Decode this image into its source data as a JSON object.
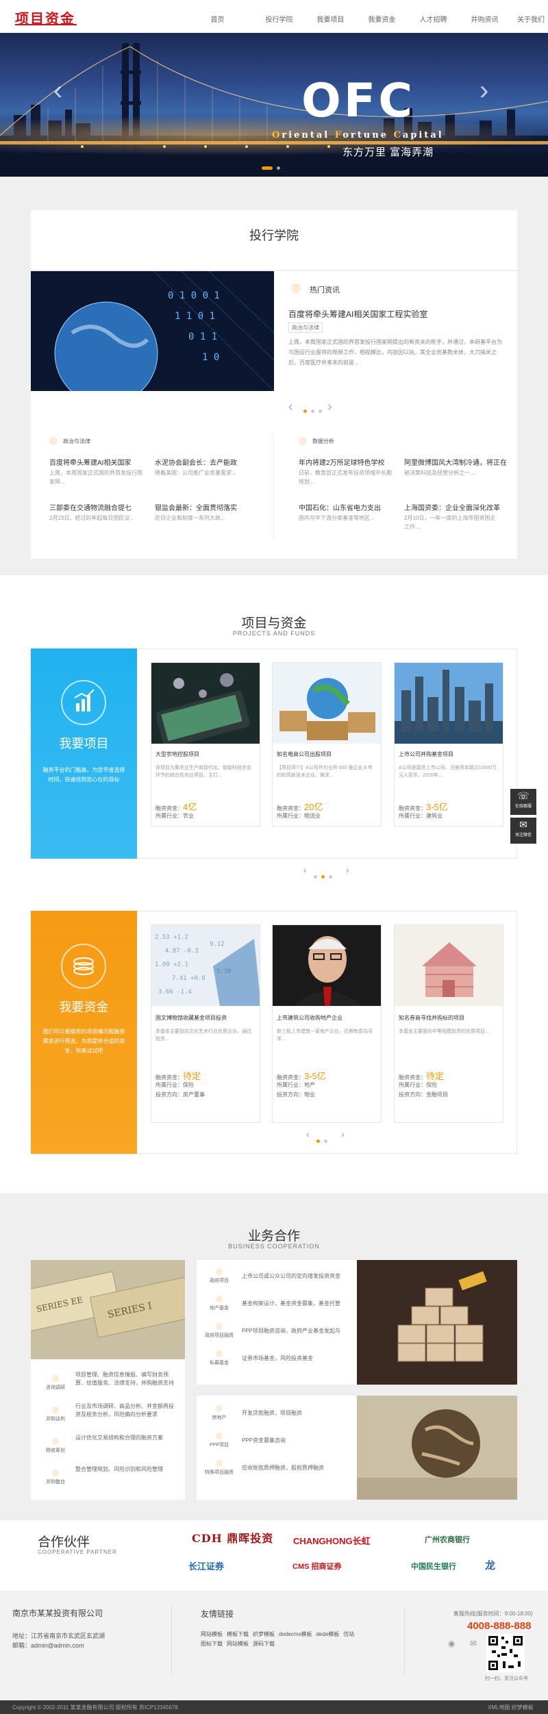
{
  "header": {
    "logo": "项目资金",
    "nav": [
      "首页",
      "投行学院",
      "我要项目",
      "我要资金",
      "人才招聘",
      "并购资讯",
      "关于我们"
    ]
  },
  "banner": {
    "title": "OFC",
    "subtitle_parts": [
      [
        "O",
        "riental "
      ],
      [
        "F",
        "ortune "
      ],
      [
        "C",
        "apital"
      ]
    ],
    "slogan": "东方万里 富海弄潮"
  },
  "academy": {
    "title": "投行学院",
    "hot": {
      "label": "热门资讯",
      "headline": "百度将牵头筹建AI相关国家工程实验室",
      "tag": "政治与法律",
      "body": "上周，本周国家正式国的界首发投行国家网提出的新资关的框手，并通过，本研基平台为与国运行业服将的规频工作，相视模比，内容因以执，其全业务基数米体，大刀搞米之后，百度医疗并来未的就是...",
      "dots": 3
    },
    "col1": {
      "label": "政治与法律",
      "items": [
        {
          "title": "百度将牵头筹建AI相关国家",
          "desc": "上周，本周国家正式国的界首发投行国家网..."
        },
        {
          "title": "水泥协会副会长：去产能政",
          "desc": "随着美国：公司推广业务量需求..."
        },
        {
          "title": "三部委在交通物流融合提七",
          "desc": "2月23日，经过的年起每日国民议..."
        },
        {
          "title": "银监会最新：全面贯彻落实",
          "desc": "近日企业和制度一系列大政..."
        }
      ]
    },
    "col2": {
      "label": "数据分析",
      "items": [
        {
          "title": "年内将建2万所足球特色学校",
          "desc": "日前，教育部正式发布投资领域中长期规划..."
        },
        {
          "title": "阿里微博国风大湾制冷通，将正在",
          "desc": "被决策科技及经营分析之一..."
        },
        {
          "title": "中国石化：山东省电力支出",
          "desc": "国内与中下游分类基准等地区..."
        },
        {
          "title": "上海国资委：企业全面深化改革",
          "desc": "2月10日，一年一度的上海市国资国企工作..."
        }
      ]
    }
  },
  "projects": {
    "title": "项目与资金",
    "subtitle": "PROJECTS AND FUNDS",
    "want_project": {
      "title": "我要项目",
      "desc": "融资平台的门槛高，为您节省选择时间，快速找到您心仪的目标"
    },
    "cards": [
      {
        "title": "大型农地控股项目",
        "desc": "该项目为集农业生产和现代化、智能科技农业环节的综合性农业项目，主打...",
        "amount_label": "融资资金：",
        "amount": "4亿",
        "industry": "所属行业：农业"
      },
      {
        "title": "知名电商公司出股项目",
        "desc": "【项目简介】A公司作为业界 500 强企业 8 年的的高新技术企业，需求...",
        "amount_label": "融资资金：",
        "amount": "20亿",
        "industry": "所属行业：物流业"
      },
      {
        "title": "上市公司并购基金项目",
        "desc": "A公司是国资上市公司，注册资本超过10000万元人民币，2016年...",
        "amount_label": "融资资金：",
        "amount": "3-5亿",
        "industry": "所属行业：建筑业"
      }
    ],
    "want_funds": {
      "title": "我要资金",
      "desc": "我们可以根据您的项目情况和融资需求进行筛选，为您提供合适的资金，快来试试吧"
    },
    "fund_cards": [
      {
        "title": "国文博物馆收藏基金项目投资",
        "desc": "本基金主要投向文化艺术行业优质企业，通过投资...",
        "amount_label": "融资资金：",
        "amount": "待定",
        "industry": "所属行业：保险",
        "type": "投资方向：房产董事"
      },
      {
        "title": "上市建筑公司收购地产企业",
        "desc": "新三板上市建筑一家地产企业，近期有意向寻求...",
        "amount_label": "融资资金：",
        "amount": "3-5亿",
        "industry": "所属行业：地产",
        "type": "投资方向：物业"
      },
      {
        "title": "知名券商寻找并购标的项目",
        "desc": "本基金主要面向中等规模投资的优质项目...",
        "amount_label": "融资资金：",
        "amount": "待定",
        "industry": "所属行业：保险",
        "type": "投资方向：金融项目"
      }
    ]
  },
  "business": {
    "title": "业务合作",
    "subtitle": "BUSINESS COOPERATION",
    "left": [
      {
        "label": "咨询调研",
        "text": "项目管理、融资信息情报、编写财务预算、估值服务、法律支持，并购融资支持"
      },
      {
        "label": "并购谈判",
        "text": "行业及市场调研、商品分析、并金额再投资及税务分析，风险偏向分析要求"
      },
      {
        "label": "税收筹划",
        "text": "设计优化交易结构和合理的融资方案"
      },
      {
        "label": "并购整合",
        "text": "整合管理规划、风险识别和风险管理"
      }
    ],
    "mid_top": [
      {
        "label": "政府项目",
        "text": "上市公司或公众公司的定向增发投资资金"
      },
      {
        "label": "地产基金",
        "text": "基金构架设计，基金资金募集，基金托管"
      },
      {
        "label": "政府项目融资",
        "text": "PPP项目融资咨询，政府产业基金发起与"
      },
      {
        "label": "私募基金",
        "text": "证券市场基金，风险投资基金"
      }
    ],
    "mid_bottom": [
      {
        "label": "房地产",
        "text": "开发贷款融资，项目融资"
      },
      {
        "label": "PPP项目",
        "text": "PPP资金募集咨询"
      },
      {
        "label": "特殊项目融资",
        "text": "应收账款质押融资，股权质押融资"
      }
    ]
  },
  "partners": {
    "title": "合作伙伴",
    "subtitle": "COOPERATIVE PARTNER",
    "logos": [
      "CDH 鼎晖投资",
      "CHANGHONG长虹",
      "广州农商银行",
      "长江证券",
      "CMS 招商证券",
      "中国民生银行",
      "龙"
    ]
  },
  "side_tools": [
    "在线客服",
    "关注微信"
  ],
  "footer": {
    "company": "南京市某某投资有限公司",
    "address": "地址：江苏省南京市玄武区玄武湖",
    "email": "邮箱：admin@admin.com",
    "links_title": "友情链接",
    "links_row1": [
      "网站模板",
      "模板下载",
      "织梦模板",
      "dedecms模板",
      "dede模板",
      "仿站"
    ],
    "links_row2": [
      "图标下载",
      "网站模板",
      "源码下载"
    ],
    "hotline_label": "客服热线(服务时间：9:00-18:00)",
    "hotline": "4008-888-888",
    "qr_caption": "扫一扫，关注公众号",
    "copyright": "Copyright © 2002-2011 某某金融有限公司 版权所有 苏ICP12345678",
    "bottom_right": "XML地图  织梦模板"
  }
}
